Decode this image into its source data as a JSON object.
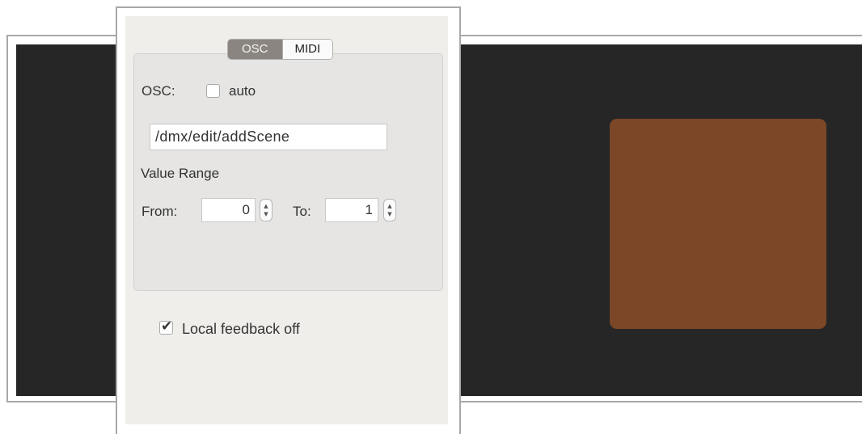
{
  "tabs": {
    "osc": "OSC",
    "midi": "MIDI",
    "selected": "OSC"
  },
  "osc": {
    "label": "OSC:",
    "auto_label": "auto",
    "auto_checked": false,
    "address": "/dmx/edit/addScene"
  },
  "value_range": {
    "heading": "Value Range",
    "from_label": "From:",
    "from_value": "0",
    "to_label": "To:",
    "to_value": "1"
  },
  "local_feedback": {
    "label": "Local feedback off",
    "checked": true
  },
  "pad": {
    "color": "#7b4726"
  },
  "icons": {
    "stepper": "up-down-stepper-icon",
    "check": "checkmark-icon"
  }
}
